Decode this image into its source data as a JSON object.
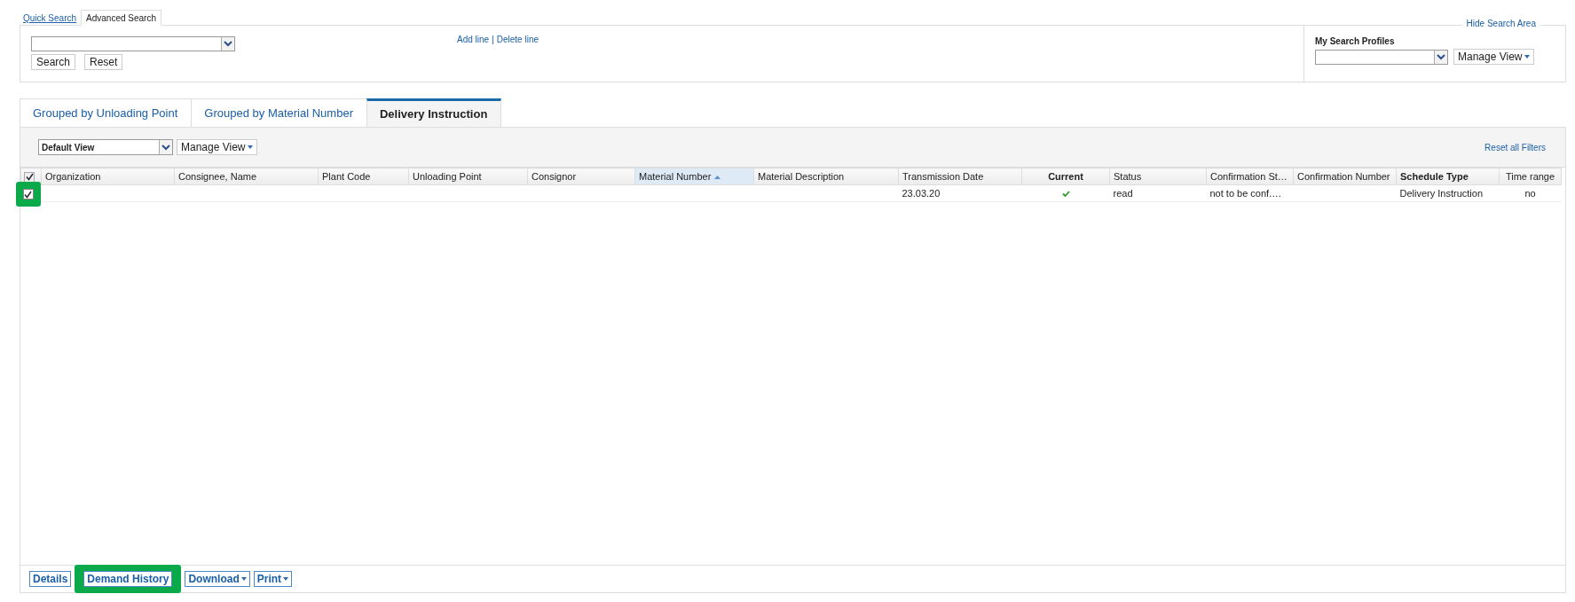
{
  "search_tabs": [
    {
      "label": "Quick Search",
      "selected": false
    },
    {
      "label": "Advanced Search",
      "selected": true
    }
  ],
  "search_area": {
    "buttons": [
      "Search",
      "Reset"
    ],
    "line_links": [
      "Add line",
      "Delete line"
    ],
    "link_separator": "|",
    "hide_link": "Hide Search Area",
    "profiles": {
      "label": "My Search Profiles",
      "manage_view": "Manage View"
    }
  },
  "result_tabs": [
    {
      "label": "Grouped by Unloading Point",
      "selected": false
    },
    {
      "label": "Grouped by Material Number",
      "selected": false
    },
    {
      "label": "Delivery Instruction",
      "selected": true
    }
  ],
  "toolbar": {
    "view_select": "Default View",
    "manage_view": "Manage View",
    "reset_filters": "Reset all Filters"
  },
  "table": {
    "select_all": {
      "checked": true
    },
    "columns": [
      {
        "label": "Organization"
      },
      {
        "label": "Consignee, Name"
      },
      {
        "label": "Plant Code"
      },
      {
        "label": "Unloading Point"
      },
      {
        "label": "Consignor"
      },
      {
        "label": "Material Number",
        "sorted_ascending": true
      },
      {
        "label": "Material Description"
      },
      {
        "label": "Transmission Date"
      },
      {
        "label": "Current"
      },
      {
        "label": "Status"
      },
      {
        "label": "Confirmation St…"
      },
      {
        "label": "Confirmation Number"
      },
      {
        "label": "Schedule Type"
      },
      {
        "label": "Time range"
      }
    ],
    "rows": [
      {
        "selected": true,
        "highlighted": true,
        "transmission_date": "23.03.20",
        "current": true,
        "status": "read",
        "confirmation_status": "not to be conf.…",
        "schedule_type": "Delivery Instruction",
        "time_range": "no"
      }
    ]
  },
  "bottom_buttons": [
    {
      "label": "Details",
      "menu": false,
      "highlighted": false
    },
    {
      "label": "Demand History",
      "menu": false,
      "highlighted": true
    },
    {
      "label": "Download",
      "menu": true,
      "highlighted": false
    },
    {
      "label": "Print",
      "menu": true,
      "highlighted": false
    }
  ]
}
